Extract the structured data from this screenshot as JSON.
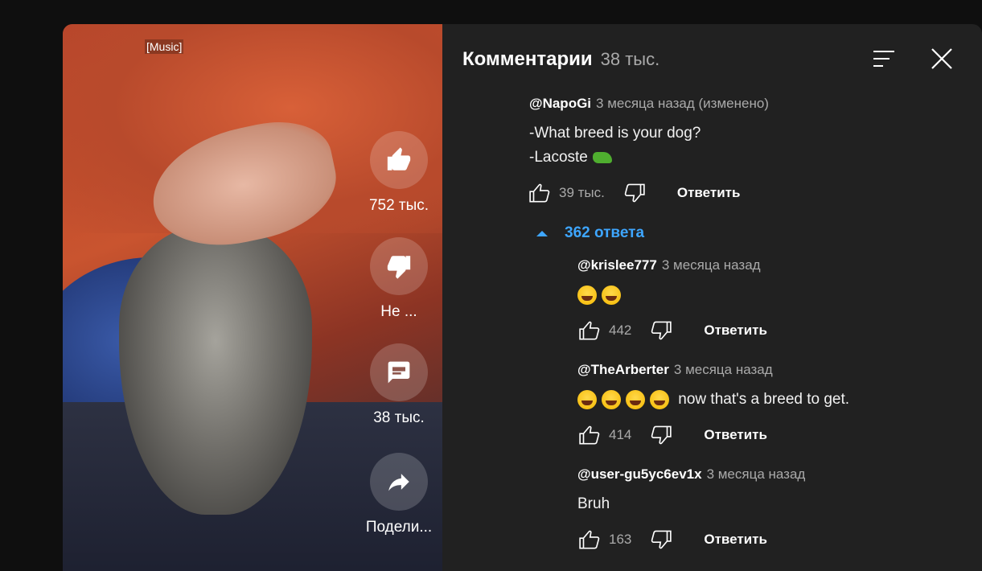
{
  "video": {
    "music_label": "[Music]",
    "actions": {
      "like_count": "752 тыс.",
      "dislike_label": "Не ...",
      "comments_count": "38 тыс.",
      "share_label": "Подели..."
    }
  },
  "comments_panel": {
    "title": "Комментарии",
    "count": "38 тыс.",
    "top_comment": {
      "author": "@NapoGi",
      "time": "3 месяца назад (изменено)",
      "line1": "-What breed is your dog?",
      "line2": "-Lacoste",
      "likes": "39 тыс.",
      "reply_label": "Ответить"
    },
    "replies_toggle": "362 ответа",
    "replies": [
      {
        "author": "@krislee777",
        "time": "3 месяца назад",
        "text": "",
        "emoji_count": 2,
        "likes": "442",
        "reply_label": "Ответить"
      },
      {
        "author": "@TheArberter",
        "time": "3 месяца назад",
        "text": "now that's a breed to get.",
        "emoji_count": 4,
        "likes": "414",
        "reply_label": "Ответить"
      },
      {
        "author": "@user-gu5yc6ev1x",
        "time": "3 месяца назад",
        "text": "Bruh",
        "emoji_count": 0,
        "likes": "163",
        "reply_label": "Ответить"
      }
    ]
  },
  "colors": {
    "panel_bg": "#212121",
    "page_bg": "#0f0f0f",
    "link_blue": "#3ea6ff",
    "secondary_text": "#aaaaaa"
  },
  "icons": [
    "like-icon",
    "dislike-icon",
    "comment-icon",
    "share-icon",
    "sort-icon",
    "close-icon",
    "caret-up-icon"
  ]
}
